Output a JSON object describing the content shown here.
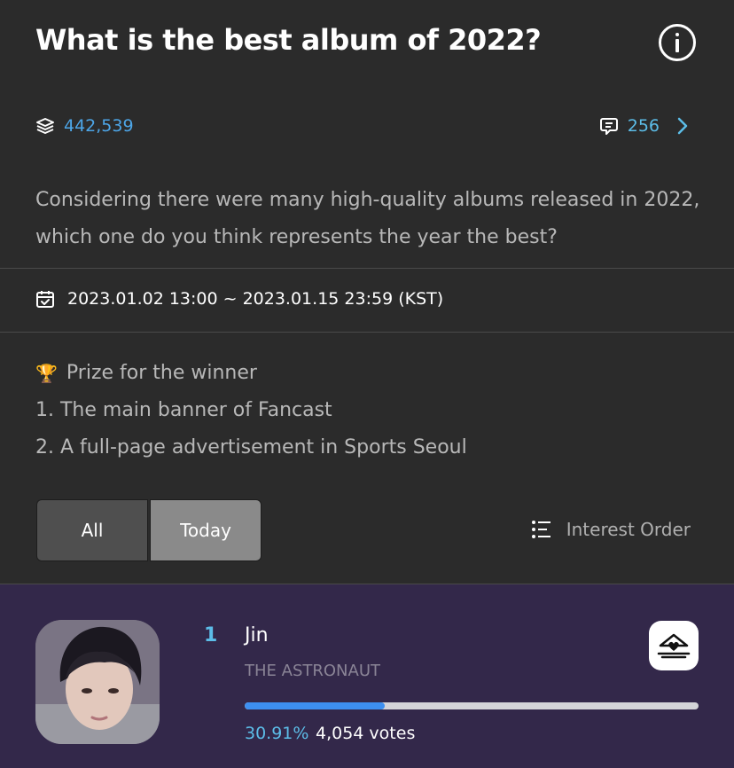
{
  "header": {
    "title": "What is the best album of 2022?",
    "info_icon": "info-circle-icon"
  },
  "stats": {
    "participants": "442,539",
    "participants_icon": "layers-icon",
    "comments": "256",
    "comments_icon": "speech-bubble-icon",
    "comments_chevron_icon": "chevron-right-icon"
  },
  "description": {
    "line1": "Considering there were many high-quality albums released in 2022,",
    "line2": "which one do you think represents the year the best?"
  },
  "period": {
    "icon": "calendar-check-icon",
    "text": "2023.01.02 13:00 ~ 2023.01.15 23:59 (KST)"
  },
  "prize": {
    "icon": "trophy-icon",
    "heading": "Prize for the winner",
    "items": [
      "1. The main banner of Fancast",
      "2. A full-page advertisement in Sports Seoul"
    ]
  },
  "tabs": [
    {
      "label": "All",
      "selected": false
    },
    {
      "label": "Today",
      "selected": true
    }
  ],
  "sort": {
    "icon": "list-order-icon",
    "label": "Interest Order"
  },
  "entries": [
    {
      "rank": "1",
      "name": "Jin",
      "album": "THE ASTRONAUT",
      "percent_text": "30.91%",
      "percent": 30.91,
      "votes": "4,054 votes",
      "vote_icon": "heart-ballot-icon"
    }
  ],
  "colors": {
    "background": "#2b2b2b",
    "entry_background": "#33284a",
    "accent": "#5cbde8",
    "progress_fill": "#3d8ff0",
    "trophy": "#e9a825"
  }
}
